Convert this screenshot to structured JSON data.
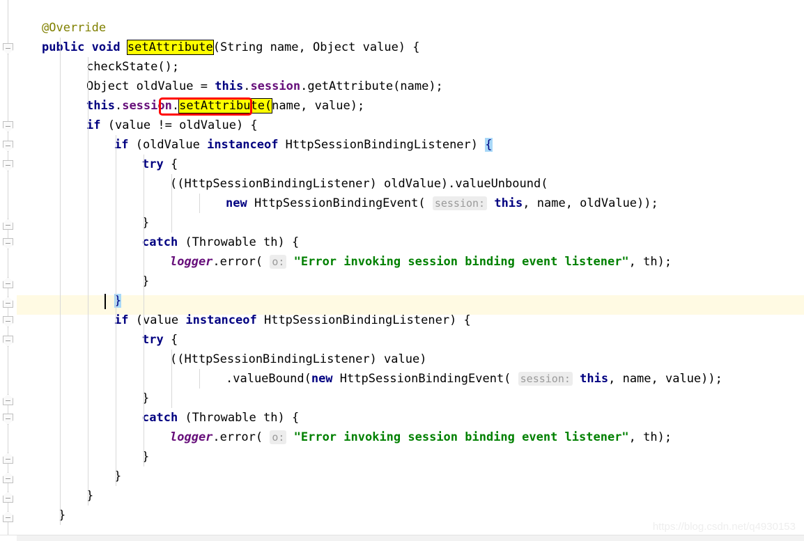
{
  "editor": {
    "language": "java",
    "font_size_px": 17,
    "line_height_px": 28,
    "background": "#ffffff",
    "current_line_background": "#fffae3",
    "search_highlight_color": "#ffff00",
    "brace_match_color": "#a8d8f8",
    "annotation_box_color": "#ff0000",
    "keyword_color": "#000080",
    "string_color": "#008000",
    "field_color": "#660e7a",
    "annotation_color": "#808000",
    "hint_chip_background": "#ededed",
    "hint_chip_color": "#9a9a9a",
    "indent_guide_color": "#d8d8d8",
    "gutter_rail_color": "#d4d4d4"
  },
  "watermark": {
    "text": "https://blog.csdn.net/q4930153"
  },
  "search": {
    "term": "setAttribute",
    "occurrences": 2
  },
  "annotations": [
    {
      "name": "red-box-setattribute-call",
      "target": "this.session.setAttribute("
    }
  ],
  "code_lines": [
    {
      "n": 1,
      "indent": 1,
      "text": "@Override"
    },
    {
      "n": 2,
      "indent": 1,
      "text": "public void setAttribute(String name, Object value) {"
    },
    {
      "n": 3,
      "indent": 2,
      "text": "checkState();"
    },
    {
      "n": 4,
      "indent": 2,
      "text": "Object oldValue = this.session.getAttribute(name);"
    },
    {
      "n": 5,
      "indent": 2,
      "text": "this.session.setAttribute(name, value);"
    },
    {
      "n": 6,
      "indent": 2,
      "text": "if (value != oldValue) {"
    },
    {
      "n": 7,
      "indent": 3,
      "text": "if (oldValue instanceof HttpSessionBindingListener) {"
    },
    {
      "n": 8,
      "indent": 4,
      "text": "try {"
    },
    {
      "n": 9,
      "indent": 5,
      "text": "((HttpSessionBindingListener) oldValue).valueUnbound("
    },
    {
      "n": 10,
      "indent": 7,
      "text": "new HttpSessionBindingEvent( session: this, name, oldValue));"
    },
    {
      "n": 11,
      "indent": 4,
      "text": "}"
    },
    {
      "n": 12,
      "indent": 4,
      "text": "catch (Throwable th) {"
    },
    {
      "n": 13,
      "indent": 5,
      "text": "logger.error( o: \"Error invoking session binding event listener\", th);"
    },
    {
      "n": 14,
      "indent": 4,
      "text": "}"
    },
    {
      "n": 15,
      "indent": 3,
      "text": "}"
    },
    {
      "n": 16,
      "indent": 3,
      "text": "if (value instanceof HttpSessionBindingListener) {"
    },
    {
      "n": 17,
      "indent": 4,
      "text": "try {"
    },
    {
      "n": 18,
      "indent": 5,
      "text": "((HttpSessionBindingListener) value)"
    },
    {
      "n": 19,
      "indent": 6,
      "text": ".valueBound(new HttpSessionBindingEvent( session: this, name, value));"
    },
    {
      "n": 20,
      "indent": 4,
      "text": "}"
    },
    {
      "n": 21,
      "indent": 4,
      "text": "catch (Throwable th) {"
    },
    {
      "n": 22,
      "indent": 5,
      "text": "logger.error( o: \"Error invoking session binding event listener\", th);"
    },
    {
      "n": 23,
      "indent": 4,
      "text": "}"
    },
    {
      "n": 24,
      "indent": 3,
      "text": "}"
    },
    {
      "n": 25,
      "indent": 2,
      "text": "}"
    },
    {
      "n": 26,
      "indent": 1,
      "text": "}"
    }
  ],
  "current_line": 15,
  "caret_line": 15,
  "matching_braces": [
    {
      "line": 7,
      "char": "{"
    },
    {
      "line": 15,
      "char": "}"
    }
  ],
  "fold_markers": [
    {
      "line": 2,
      "type": "down"
    },
    {
      "line": 6,
      "type": "down"
    },
    {
      "line": 7,
      "type": "down"
    },
    {
      "line": 8,
      "type": "down"
    },
    {
      "line": 11,
      "type": "up"
    },
    {
      "line": 12,
      "type": "down"
    },
    {
      "line": 14,
      "type": "up"
    },
    {
      "line": 15,
      "type": "up"
    },
    {
      "line": 16,
      "type": "down"
    },
    {
      "line": 17,
      "type": "down"
    },
    {
      "line": 20,
      "type": "up"
    },
    {
      "line": 21,
      "type": "down"
    },
    {
      "line": 23,
      "type": "up"
    },
    {
      "line": 24,
      "type": "up"
    },
    {
      "line": 25,
      "type": "up"
    },
    {
      "line": 26,
      "type": "up"
    }
  ],
  "tokens": {
    "keywords": [
      "public",
      "void",
      "if",
      "try",
      "catch",
      "new",
      "instanceof",
      "this"
    ],
    "hints": [
      "session:",
      "o:"
    ],
    "strings": [
      "\"Error invoking session binding event listener\""
    ],
    "annotation": "@Override"
  }
}
